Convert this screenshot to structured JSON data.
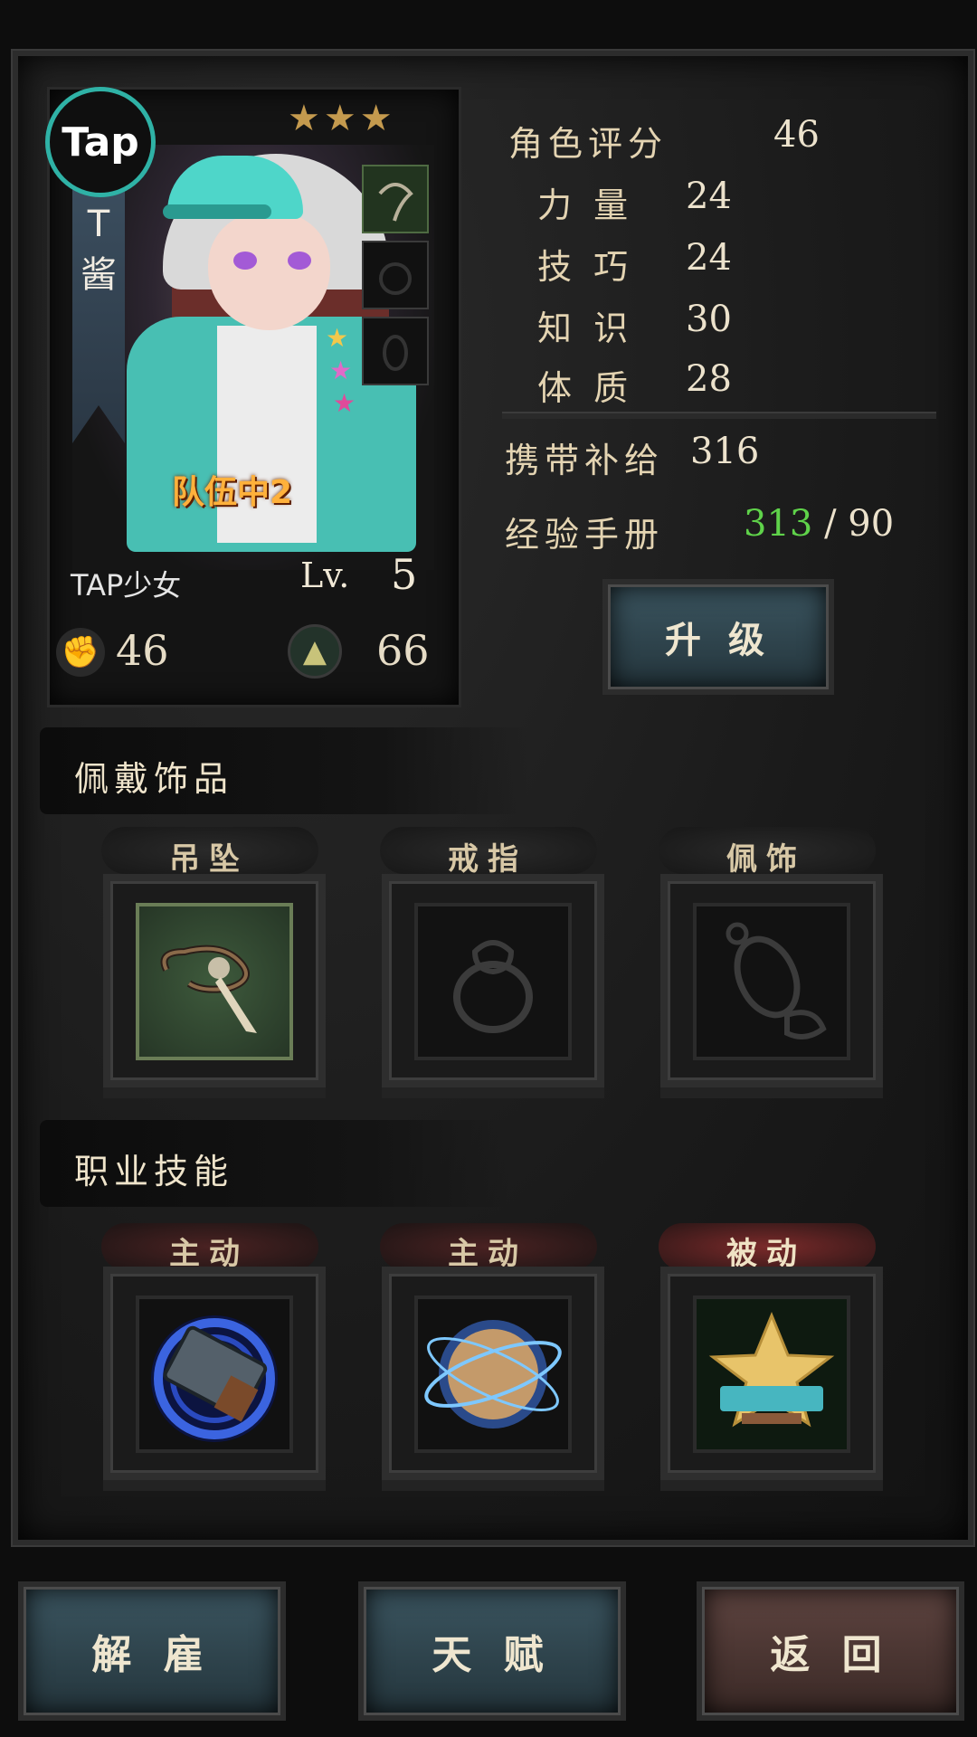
{
  "character": {
    "name_vertical": "T 酱",
    "name": "TAP少女",
    "logo": "Tap",
    "stars": "★★★",
    "team_tag": "队伍中2",
    "level_label": "Lv.",
    "level": "5",
    "attack": "46",
    "defense": "66"
  },
  "stats": {
    "rating_label": "角色评分",
    "rating": "46",
    "strength_label": "力 量",
    "strength": "24",
    "skill_label": "技 巧",
    "skill": "24",
    "knowledge_label": "知 识",
    "knowledge": "30",
    "constitution_label": "体 质",
    "constitution": "28",
    "supply_label": "携带补给",
    "supply": "316",
    "exp_label": "经验手册",
    "exp_current": "313",
    "exp_sep": " / ",
    "exp_required": "90"
  },
  "upgrade_label": "升 级",
  "accessories": {
    "title": "佩戴饰品",
    "slots": [
      {
        "label": "吊坠",
        "icon": "pendant-icon",
        "equipped": true
      },
      {
        "label": "戒指",
        "icon": "ring-icon",
        "equipped": false
      },
      {
        "label": "佩饰",
        "icon": "charm-icon",
        "equipped": false
      }
    ]
  },
  "skills": {
    "title": "职业技能",
    "items": [
      {
        "type": "主动",
        "icon": "taptap-card-skill-icon"
      },
      {
        "type": "主动",
        "icon": "globe-skill-icon"
      },
      {
        "type": "被动",
        "icon": "taptap-star-skill-icon"
      }
    ]
  },
  "buttons": {
    "dismiss": "解 雇",
    "talent": "天 赋",
    "back": "返 回"
  },
  "colors": {
    "exp_current": "#5fd24a",
    "team_tag": "#ffb13b",
    "passive_tag": "#7a2a2a",
    "active_tag": "#4a2222"
  }
}
